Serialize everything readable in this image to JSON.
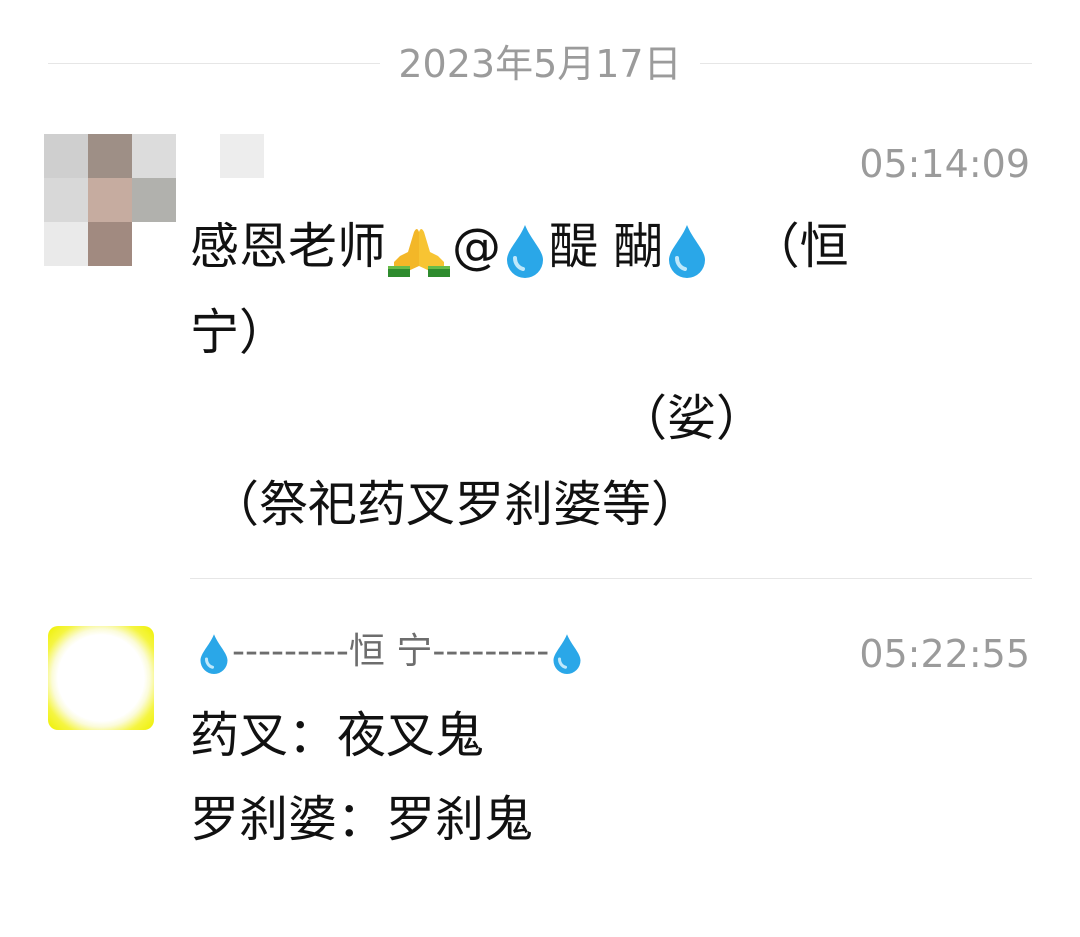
{
  "date_separator": "2023年5月17日",
  "messages": [
    {
      "time": "05:14:09",
      "text_part1": "感恩老师",
      "text_at": "@",
      "text_name": "醍 醐",
      "text_paren_start": "（恒",
      "line2": "宁）",
      "line3": "（娑）",
      "line4": "（祭祀药叉罗刹婆等）",
      "icons": {
        "pray": "folded-hands-icon",
        "drop": "droplet-icon"
      }
    },
    {
      "time": "05:22:55",
      "sender_name": "---------恒 宁---------",
      "line1": "药叉：夜叉鬼",
      "line2": "罗刹婆：罗刹鬼"
    }
  ],
  "colors": {
    "muted_text": "#9b9b9b",
    "name_text": "#6d6d6d",
    "divider": "#e6e6e6",
    "droplet": "#2aa7e8",
    "avatar_yellow": "#eef000"
  }
}
